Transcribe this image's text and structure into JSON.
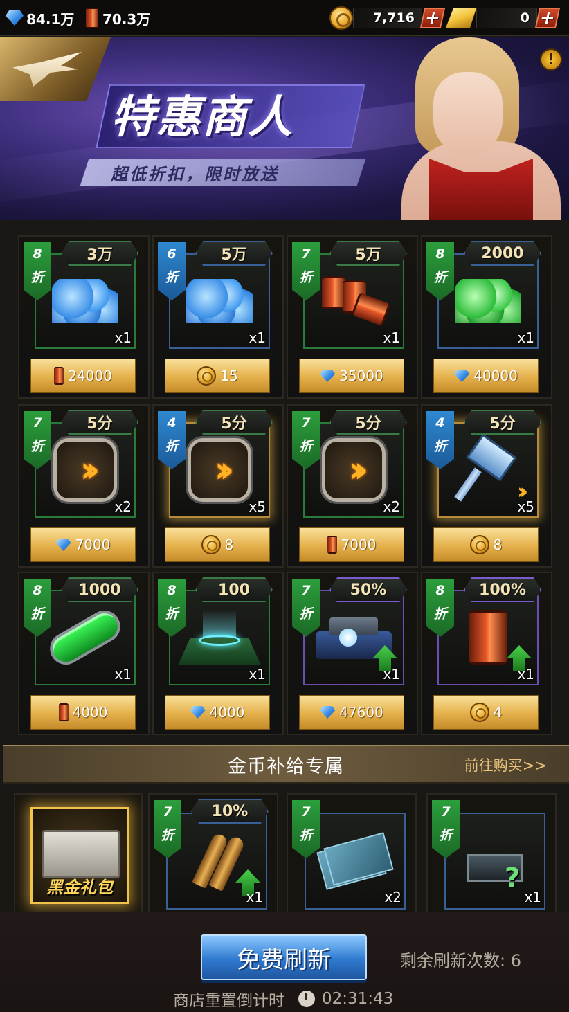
{
  "topbar": {
    "crystal": "84.1万",
    "oil": "70.3万",
    "coins": "7,716",
    "gold": "0",
    "plus": "+"
  },
  "banner": {
    "title": "特惠商人",
    "subtitle": "超低折扣，限时放送",
    "info": "!"
  },
  "discount_unit": "折",
  "items": [
    {
      "discount": "8",
      "amount": "3万",
      "qty": "x1",
      "price": "24000",
      "price_icon": "oil-barrel-icon"
    },
    {
      "discount": "6",
      "amount": "5万",
      "qty": "x1",
      "price": "15",
      "price_icon": "coin-icon"
    },
    {
      "discount": "7",
      "amount": "5万",
      "qty": "x1",
      "price": "35000",
      "price_icon": "crystal-icon"
    },
    {
      "discount": "8",
      "amount": "2000",
      "qty": "x1",
      "price": "40000",
      "price_icon": "crystal-icon"
    },
    {
      "discount": "7",
      "amount": "5分",
      "qty": "x2",
      "price": "7000",
      "price_icon": "crystal-icon"
    },
    {
      "discount": "4",
      "amount": "5分",
      "qty": "x5",
      "price": "8",
      "price_icon": "coin-icon"
    },
    {
      "discount": "7",
      "amount": "5分",
      "qty": "x2",
      "price": "7000",
      "price_icon": "oil-barrel-icon"
    },
    {
      "discount": "4",
      "amount": "5分",
      "qty": "x5",
      "price": "8",
      "price_icon": "coin-icon"
    },
    {
      "discount": "8",
      "amount": "1000",
      "qty": "x1",
      "price": "4000",
      "price_icon": "oil-barrel-icon"
    },
    {
      "discount": "8",
      "amount": "100",
      "qty": "x1",
      "price": "4000",
      "price_icon": "crystal-icon"
    },
    {
      "discount": "7",
      "amount": "50%",
      "qty": "x1",
      "price": "47600",
      "price_icon": "crystal-icon"
    },
    {
      "discount": "8",
      "amount": "100%",
      "qty": "x1",
      "price": "4",
      "price_icon": "coin-icon"
    }
  ],
  "gold_section": {
    "title": "金币补给专属",
    "link": "前往购买>>",
    "chest_label": "黑金礼包",
    "items": [
      {
        "discount": "7",
        "amount": "10%",
        "qty": "x1"
      },
      {
        "discount": "7",
        "amount": "",
        "qty": "x2"
      },
      {
        "discount": "7",
        "amount": "",
        "qty": "x1"
      }
    ]
  },
  "footer": {
    "refresh_button": "免费刷新",
    "remaining": "剩余刷新次数: 6",
    "reset_label": "商店重置倒计时",
    "timer": "02:31:43"
  },
  "colors": {
    "discount_green": "#2b9e3c",
    "discount_blue": "#2f88d0",
    "price_gold": "#e4b04a",
    "refresh_blue": "#2f7ad0"
  }
}
